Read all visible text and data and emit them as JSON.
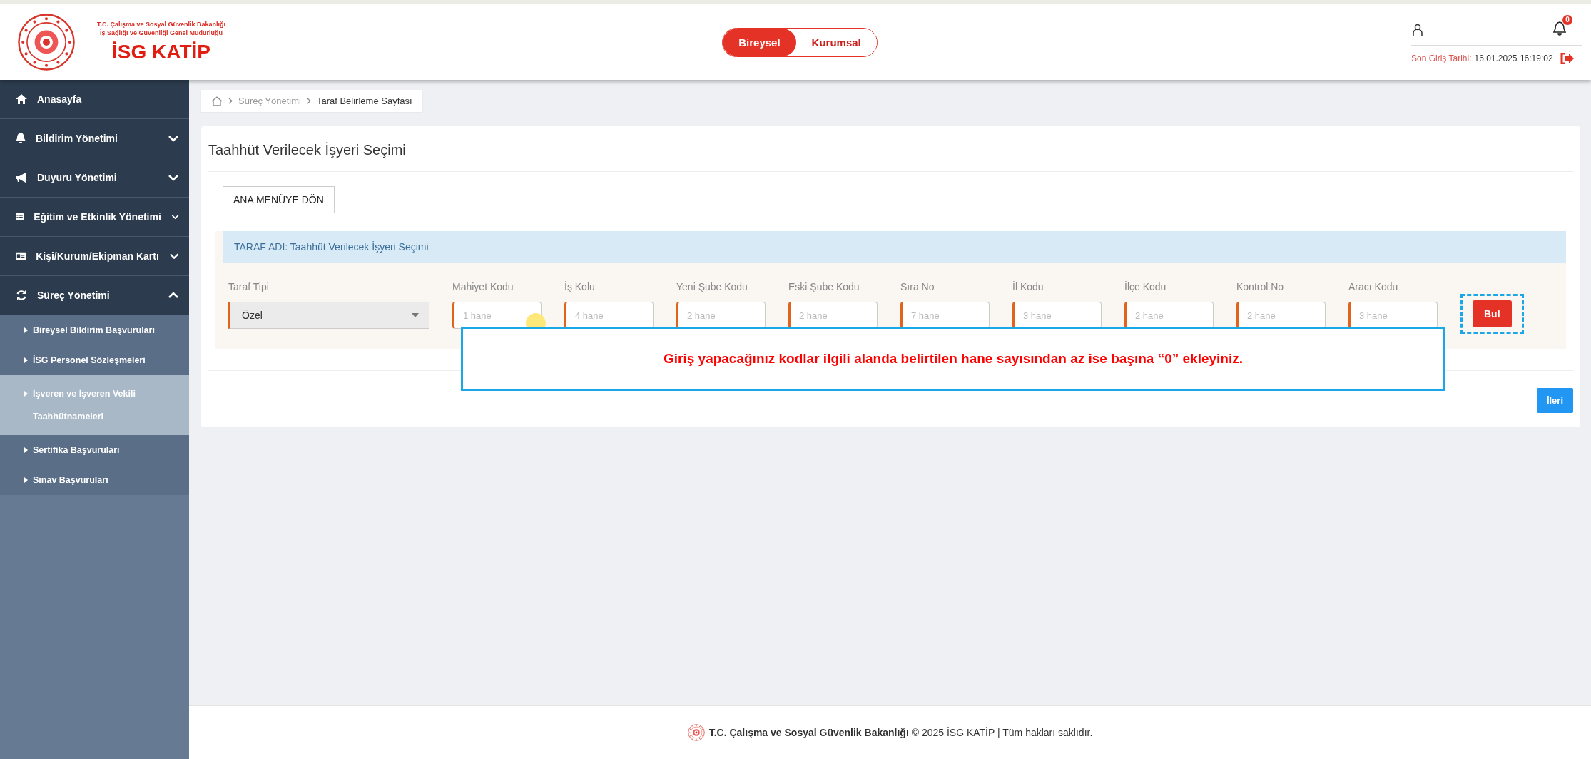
{
  "header": {
    "ministry_lines": [
      "T.C. Çalışma ve Sosyal Güvenlik Bakanlığı",
      "İş Sağlığı ve Güvenliği Genel Müdürlüğü"
    ],
    "app_name": "İSG KATİP",
    "mode_toggle": [
      {
        "label": "Bireysel",
        "selected": true
      },
      {
        "label": "Kurumsal",
        "selected": false
      }
    ],
    "notification_count": "0",
    "last_login_label": "Son Giriş Tarihi:",
    "last_login_value": "16.01.2025 16:19:02"
  },
  "sidebar": {
    "items": [
      {
        "label": "Anasayfa"
      },
      {
        "label": "Bildirim Yönetimi",
        "expanded": false
      },
      {
        "label": "Duyuru Yönetimi",
        "expanded": false
      },
      {
        "label": "Eğitim ve Etkinlik Yönetimi",
        "expanded": false
      },
      {
        "label": "Kişi/Kurum/Ekipman Kartı",
        "expanded": false
      },
      {
        "label": "Süreç Yönetimi",
        "expanded": true,
        "children": [
          {
            "label": "Bireysel Bildirim Başvuruları",
            "selected": false
          },
          {
            "label": "İSG Personel Sözleşmeleri",
            "selected": false
          },
          {
            "label": "İşveren ve İşveren Vekili Taahhütnameleri",
            "selected": true
          },
          {
            "label": "Sertifika Başvuruları",
            "selected": false
          },
          {
            "label": "Sınav Başvuruları",
            "selected": false
          }
        ]
      }
    ]
  },
  "breadcrumb": [
    "Süreç Yönetimi",
    "Taraf Belirleme Sayfası"
  ],
  "page_title": "Taahhüt Verilecek İşyeri Seçimi",
  "back_button": "ANA MENÜYE DÖN",
  "section_title": "TARAF ADI: Taahhüt Verilecek İşyeri Seçimi",
  "fields": [
    {
      "kind": "select",
      "label": "Taraf Tipi",
      "value": "Özel"
    },
    {
      "kind": "text",
      "label": "Mahiyet Kodu",
      "placeholder": "1 hane"
    },
    {
      "kind": "text",
      "label": "İş Kolu",
      "placeholder": "4 hane"
    },
    {
      "kind": "text",
      "label": "Yeni Şube Kodu",
      "placeholder": "2 hane"
    },
    {
      "kind": "text",
      "label": "Eski Şube Kodu",
      "placeholder": "2 hane"
    },
    {
      "kind": "text",
      "label": "Sıra No",
      "placeholder": "7 hane"
    },
    {
      "kind": "text",
      "label": "İl Kodu",
      "placeholder": "3 hane"
    },
    {
      "kind": "text",
      "label": "İlçe Kodu",
      "placeholder": "2 hane"
    },
    {
      "kind": "text",
      "label": "Kontrol No",
      "placeholder": "2 hane"
    },
    {
      "kind": "text",
      "label": "Aracı Kodu",
      "placeholder": "3 hane"
    }
  ],
  "find_button": "Bul",
  "callout": "Giriş yapacağınız kodlar ilgili alanda belirtilen hane sayısından az ise başına “0” ekleyiniz.",
  "next_button": "İleri",
  "footer": "**T.C. Çalışma ve Sosyal Güvenlik Bakanlığı** © 2025 İSG KATİP | Tüm hakları saklıdır."
}
